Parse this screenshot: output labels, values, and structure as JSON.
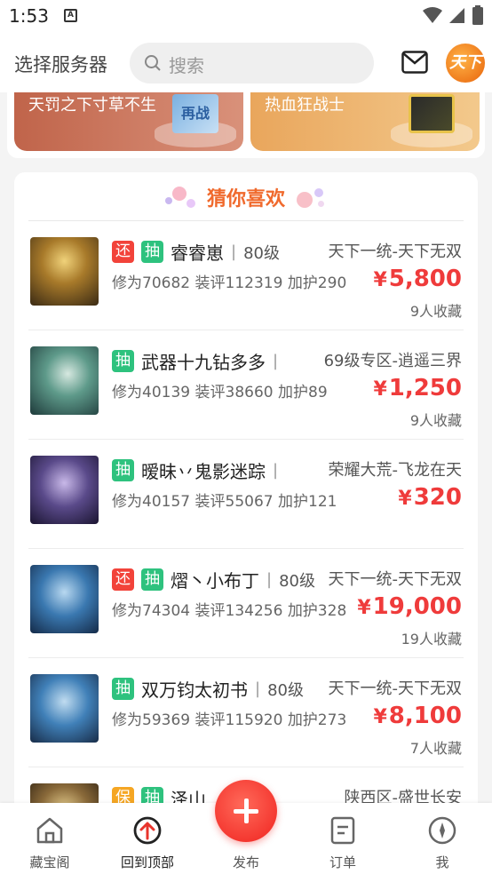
{
  "status_bar": {
    "time": "1:53",
    "badge": "A"
  },
  "header": {
    "server_select": "选择服务器",
    "search_placeholder": "搜索",
    "avatar_text": "天下"
  },
  "banners": [
    {
      "text": "天罚之下寸草不生",
      "card_text": "再战"
    },
    {
      "text": "热血狂战士"
    }
  ],
  "section_title": "猜你喜欢",
  "items": [
    {
      "tags": [
        "还",
        "抽"
      ],
      "name": "睿睿崽",
      "level": "80级",
      "server": "天下一统-天下无双",
      "xiuwei": "修为70682",
      "zhuangping": "装评112319",
      "jiahu": "加护290",
      "price": "5,800",
      "fav": "9人收藏"
    },
    {
      "tags": [
        "抽"
      ],
      "name": "武器十九钻多多",
      "level": "",
      "server": "69级专区-逍遥三界",
      "xiuwei": "修为40139",
      "zhuangping": "装评38660",
      "jiahu": "加护89",
      "price": "1,250",
      "fav": "9人收藏"
    },
    {
      "tags": [
        "抽"
      ],
      "name": "暧昧丷鬼影迷踪",
      "level": "",
      "server": "荣耀大荒-飞龙在天",
      "xiuwei": "修为40157",
      "zhuangping": "装评55067",
      "jiahu": "加护121",
      "price": "320",
      "fav": ""
    },
    {
      "tags": [
        "还",
        "抽"
      ],
      "name": "熠丶小布丁",
      "level": "80级",
      "server": "天下一统-天下无双",
      "xiuwei": "修为74304",
      "zhuangping": "装评134256",
      "jiahu": "加护328",
      "price": "19,000",
      "fav": "19人收藏"
    },
    {
      "tags": [
        "抽"
      ],
      "name": "双万钧太初书",
      "level": "80级",
      "server": "天下一统-天下无双",
      "xiuwei": "修为59369",
      "zhuangping": "装评115920",
      "jiahu": "加护273",
      "price": "8,100",
      "fav": "7人收藏"
    },
    {
      "tags": [
        "保",
        "抽"
      ],
      "name": "泽山",
      "level": "",
      "server": "陕西区-盛世长安",
      "xiuwei": "",
      "zhuangping": "",
      "jiahu": "",
      "price": "",
      "fav": ""
    }
  ],
  "currency": "¥",
  "bottom_nav": {
    "home": "藏宝阁",
    "top": "回到顶部",
    "publish": "发布",
    "orders": "订单",
    "me": "我"
  },
  "colors": {
    "price_red": "#ef3b3b",
    "tag_green": "#2ec27e",
    "tag_red": "#f2433a",
    "title_orange": "#f06a2d"
  }
}
